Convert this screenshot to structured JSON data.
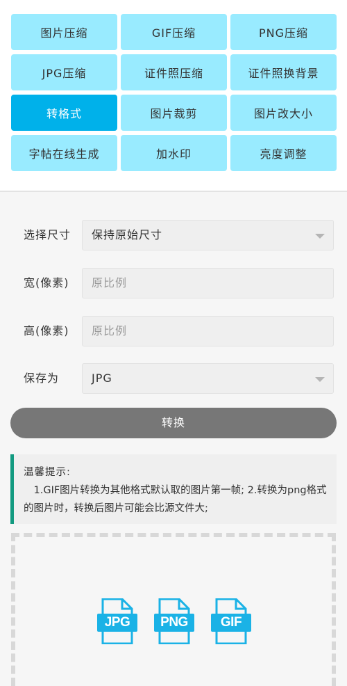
{
  "tools": [
    {
      "label": "图片压缩",
      "active": false
    },
    {
      "label": "GIF压缩",
      "active": false
    },
    {
      "label": "PNG压缩",
      "active": false
    },
    {
      "label": "JPG压缩",
      "active": false
    },
    {
      "label": "证件照压缩",
      "active": false
    },
    {
      "label": "证件照换背景",
      "active": false
    },
    {
      "label": "转格式",
      "active": true
    },
    {
      "label": "图片裁剪",
      "active": false
    },
    {
      "label": "图片改大小",
      "active": false
    },
    {
      "label": "字帖在线生成",
      "active": false
    },
    {
      "label": "加水印",
      "active": false
    },
    {
      "label": "亮度调整",
      "active": false
    }
  ],
  "form": {
    "size": {
      "label": "选择尺寸",
      "value": "保持原始尺寸"
    },
    "width": {
      "label": "宽(像素)",
      "placeholder": "原比例"
    },
    "height": {
      "label": "高(像素)",
      "placeholder": "原比例"
    },
    "format": {
      "label": "保存为",
      "value": "JPG"
    }
  },
  "convert_button": "转换",
  "tip": {
    "title": "温馨提示:",
    "body": "1.GIF图片转换为其他格式默认取的图片第一帧; 2.转换为png格式的图片时，转换后图片可能会比源文件大;"
  },
  "upload": {
    "badges": [
      "JPG",
      "PNG",
      "GIF"
    ],
    "icon_color": "#1ab2e6"
  },
  "colors": {
    "tile": "#99ebff",
    "tile_active": "#00b1ea",
    "button": "#777777",
    "tip_accent": "#129a80"
  }
}
